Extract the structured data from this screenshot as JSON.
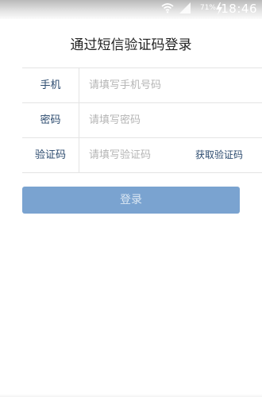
{
  "status_bar": {
    "battery_percent": "71%",
    "time": "18:46",
    "icons": [
      "wifi-icon",
      "signal-icon",
      "charging-icon"
    ]
  },
  "title": "通过短信验证码登录",
  "form": {
    "phone": {
      "label": "手机",
      "placeholder": "请填写手机号码"
    },
    "password": {
      "label": "密码",
      "placeholder": "请填写密码"
    },
    "code": {
      "label": "验证码",
      "placeholder": "请填写验证码",
      "get_code_label": "获取验证码"
    }
  },
  "login_button_label": "登录",
  "colors": {
    "label_text": "#2b4a6e",
    "button_bg": "#7aa3d0",
    "button_text": "#dbe7f3",
    "divider": "#e4e4e4",
    "placeholder": "#b5b5b5"
  }
}
